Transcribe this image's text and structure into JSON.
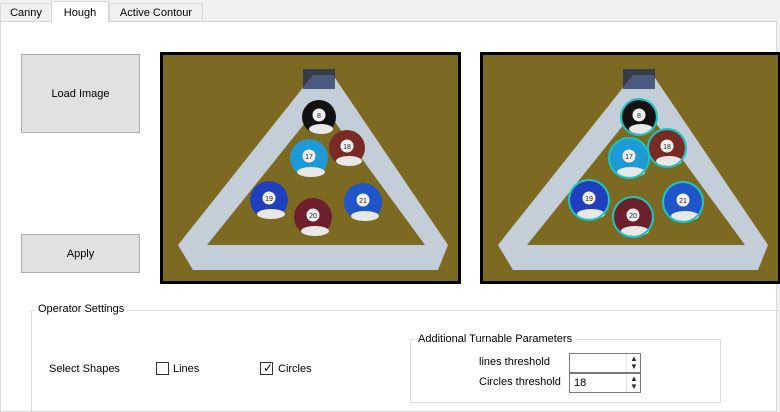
{
  "tabs": [
    {
      "label": "Canny"
    },
    {
      "label": "Hough"
    },
    {
      "label": "Active Contour"
    }
  ],
  "buttons": {
    "load_image": "Load Image",
    "apply": "Apply"
  },
  "operator_settings": {
    "title": "Operator Settings",
    "select_shapes_label": "Select Shapes",
    "lines": {
      "label": "Lines",
      "checked": false
    },
    "circles": {
      "label": "Circles",
      "checked": true
    }
  },
  "params": {
    "title": "Additional Turnable Parameters",
    "lines_threshold": {
      "label": "lines threshold",
      "value": ""
    },
    "circles_threshold": {
      "label": "Circles threshold",
      "value": "18"
    }
  },
  "balls": [
    {
      "number": "8",
      "color": "#111111"
    },
    {
      "number": "17",
      "color": "#1e9ad6"
    },
    {
      "number": "18",
      "color": "#7a2a24"
    },
    {
      "number": "19",
      "color": "#1f3fbf"
    },
    {
      "number": "20",
      "color": "#6e1f2c"
    },
    {
      "number": "21",
      "color": "#1f55c8"
    }
  ],
  "colors": {
    "felt": "#7d6a22",
    "rack": "#c8d4e4",
    "detected_circle": "#18c6c6"
  }
}
